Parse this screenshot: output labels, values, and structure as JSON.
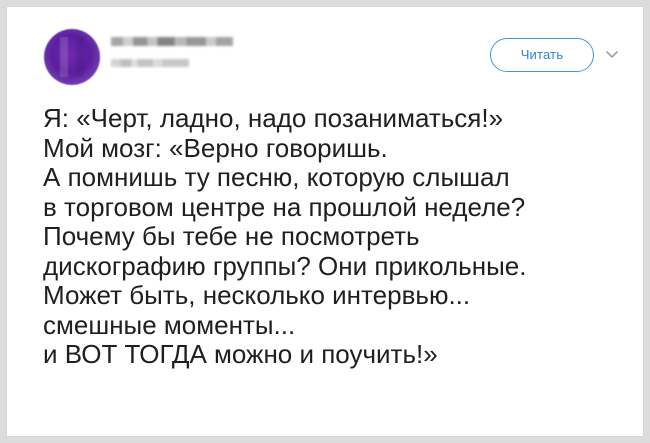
{
  "tweet": {
    "follow_label": "Читать",
    "lines": [
      "Я: «Черт, ладно, надо позаниматься!»",
      "Мой мозг: «Верно говоришь.",
      "А помнишь ту песню, которую слышал",
      "в торговом центре на прошлой неделе?",
      "Почему бы тебе не посмотреть",
      "дискографию группы? Они прикольные.",
      "Может быть, несколько интервью...",
      "смешные моменты...",
      "и ВОТ ТОГДА можно и поучить!»"
    ]
  },
  "icons": {
    "more": "chevron-down-icon"
  },
  "colors": {
    "accent": "#2b84d6",
    "text": "#1f1f1f",
    "avatar": "#5b1e9e"
  }
}
